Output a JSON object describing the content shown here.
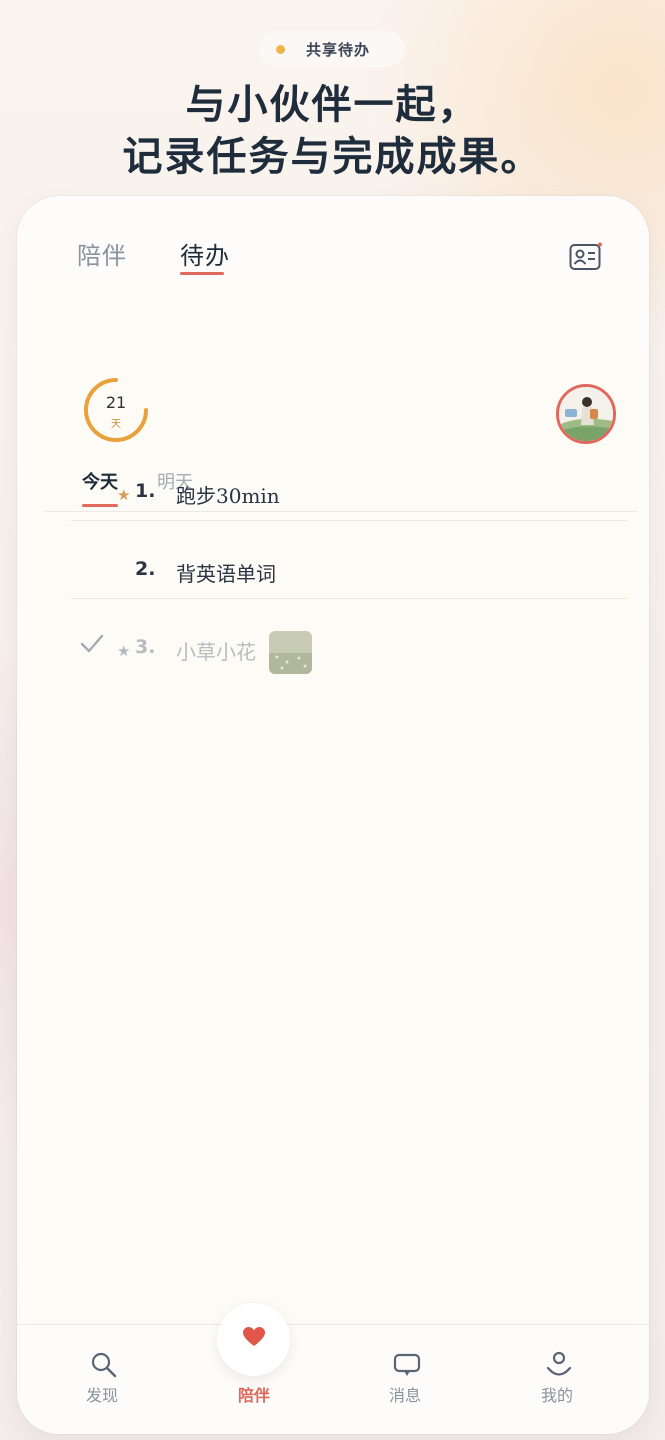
{
  "promo": {
    "pill_label": "共享待办",
    "headline_line1": "与小伙伴一起，",
    "headline_line2": "记录任务与完成成果。"
  },
  "header": {
    "tabs": [
      {
        "label": "陪伴",
        "active": false
      },
      {
        "label": "待办",
        "active": true
      }
    ],
    "right_icon": "contact-card-icon"
  },
  "streak": {
    "count": "21",
    "unit": "天"
  },
  "day_tabs": [
    {
      "label": "今天",
      "active": true
    },
    {
      "label": "明天",
      "active": false
    }
  ],
  "tasks": [
    {
      "index": "1.",
      "title": "跑步30min",
      "starred": true,
      "done": false
    },
    {
      "index": "2.",
      "title": "背英语单词",
      "starred": false,
      "done": false
    },
    {
      "index": "3.",
      "title": "小草小花",
      "starred": true,
      "done": true,
      "has_photo": true
    }
  ],
  "bottom_nav": [
    {
      "label": "发现",
      "icon": "search-icon",
      "active": false
    },
    {
      "label": "陪伴",
      "icon": "heart-icon",
      "active": true
    },
    {
      "label": "消息",
      "icon": "chat-icon",
      "active": false
    },
    {
      "label": "我的",
      "icon": "profile-icon",
      "active": false
    }
  ],
  "colors": {
    "accent": "#e0695f",
    "ring": "#e9a23b",
    "text_dark": "#1e2c3c",
    "muted": "#8a93a0"
  }
}
